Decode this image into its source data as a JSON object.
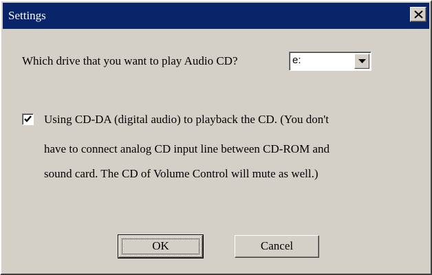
{
  "window": {
    "title": "Settings"
  },
  "drive": {
    "question": "Which drive that you want to play Audio CD?",
    "selected": "e:"
  },
  "cdda": {
    "checked": true,
    "line1": "Using CD-DA (digital audio) to playback the CD. (You don't",
    "line2": "have to connect analog CD input line between CD-ROM and",
    "line3": "sound card. The CD of Volume Control will mute as well.)"
  },
  "buttons": {
    "ok_label": "OK",
    "cancel_label": "Cancel"
  },
  "icons": {
    "close": "close-icon",
    "dropdown": "chevron-down-icon",
    "check": "checkmark-icon"
  },
  "colors": {
    "titlebar": "#0a246a",
    "face": "#d4d0c8"
  }
}
